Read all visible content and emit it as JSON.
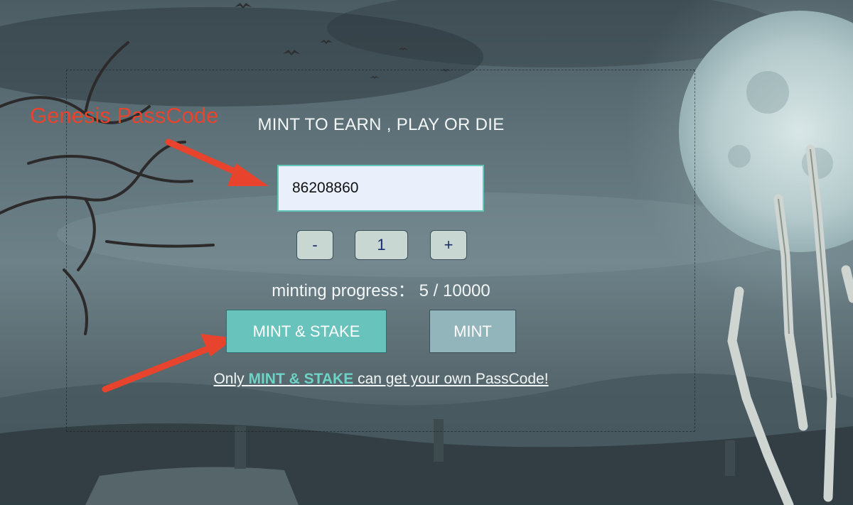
{
  "annotation": {
    "label": "Genesis PassCode",
    "color": "#e8432c"
  },
  "panel": {
    "title": "MINT TO EARN , PLAY OR DIE"
  },
  "passcode": {
    "value": "86208860"
  },
  "quantity": {
    "decrement": "-",
    "value": "1",
    "increment": "+"
  },
  "progress": {
    "label": "minting progress：",
    "value": "5 / 10000"
  },
  "actions": {
    "mint_stake": "MINT & STAKE",
    "mint": "MINT"
  },
  "note": {
    "prefix": "Only ",
    "highlight": "MINT & STAKE",
    "suffix": " can get your own PassCode!"
  },
  "colors": {
    "accent": "#67c3bb",
    "input_bg": "#e9f0fc",
    "input_border": "#62c7b9"
  }
}
